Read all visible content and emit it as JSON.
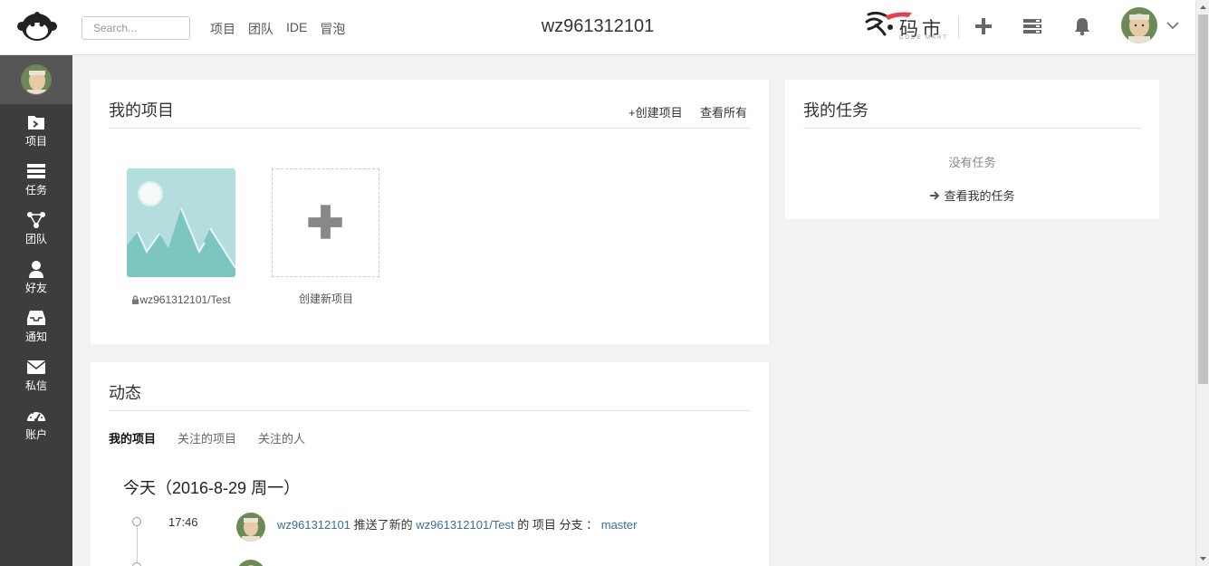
{
  "topbar": {
    "search_placeholder": "Search...",
    "nav": [
      "项目",
      "团队",
      "IDE",
      "冒泡"
    ],
    "username": "wz961312101",
    "brand_text": "码市",
    "brand_sub": "CODE MART"
  },
  "sidebar": {
    "items": [
      {
        "label": "项目",
        "icon": "project-icon"
      },
      {
        "label": "任务",
        "icon": "task-icon"
      },
      {
        "label": "团队",
        "icon": "team-icon"
      },
      {
        "label": "好友",
        "icon": "friend-icon"
      },
      {
        "label": "通知",
        "icon": "inbox-icon"
      },
      {
        "label": "私信",
        "icon": "envelope-icon"
      },
      {
        "label": "账户",
        "icon": "dashboard-icon"
      }
    ]
  },
  "projects_panel": {
    "title": "我的项目",
    "create_label": "+创建项目",
    "view_all_label": "查看所有",
    "projects": [
      {
        "name": "wz961312101/Test",
        "private": true
      }
    ],
    "new_project_label": "创建新项目"
  },
  "tasks_panel": {
    "title": "我的任务",
    "empty_text": "没有任务",
    "link_label": "查看我的任务"
  },
  "activity_panel": {
    "title": "动态",
    "tabs": [
      "我的项目",
      "关注的项目",
      "关注的人"
    ],
    "active_tab": 0,
    "day_title": "今天（2016-8-29 周一）",
    "events": [
      {
        "time": "17:46",
        "user": "wz961312101",
        "action": "推送了新的",
        "project": "wz961312101/Test",
        "suffix": "的 项目 分支 ：",
        "branch": "master"
      }
    ]
  },
  "colors": {
    "sidebar_bg": "#3d3d3d",
    "link": "#3a6f9e",
    "thumb_bg": "#b4dedd",
    "mountain": "#7cc5c0"
  }
}
